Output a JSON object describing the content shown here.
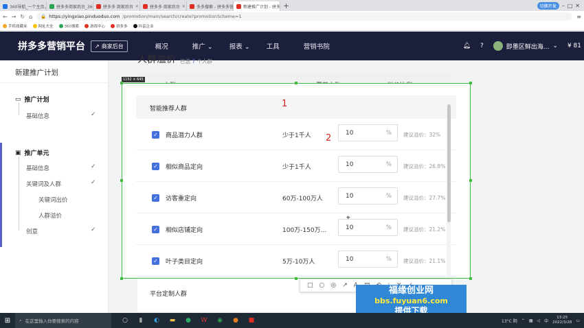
{
  "browser": {
    "tabs": [
      {
        "label": "360导航_一个主页，整个世界",
        "active": false
      },
      {
        "label": "拼多多商家后台_360搜索",
        "active": false
      },
      {
        "label": "拼多多 商家后台",
        "active": false
      },
      {
        "label": "拼多多 商家后台",
        "active": false
      },
      {
        "label": "多多搜索 - 拼多多营销平台",
        "active": false
      },
      {
        "label": "新建推广计划 - 拼多多营销平台",
        "active": true
      }
    ],
    "new_tab": "+",
    "url_host": "https://yingxiao.pinduoduo.com",
    "url_path": "/promotion/main/search/create?promotionScheme=1",
    "bookmarks": [
      "手机收藏夹",
      "网址大全",
      "360搜索",
      "游戏中心",
      "拼多多",
      "抖音企业"
    ],
    "profile_chip": "切换开发"
  },
  "header": {
    "logo": "拼多多营销平台",
    "backstage": "商家后台",
    "nav": [
      "概况",
      "推广 ⌄",
      "报表 ⌄",
      "工具",
      "营销书院"
    ],
    "user": "即墨区鲜出海...",
    "balance": "81"
  },
  "sidebar": {
    "title": "新建推广计划",
    "section1": "推广计划",
    "section1_items": [
      "基础信息"
    ],
    "section2": "推广单元",
    "section2_items": [
      "基础信息",
      "关键词及人群"
    ],
    "section2_subitems": [
      "关键词出价",
      "人群溢价"
    ],
    "section2_last": "创意",
    "check": "✓"
  },
  "page": {
    "heading": "人群溢价",
    "selected_prefix": "已选",
    "selected_count": "7",
    "selected_suffix": "个人群",
    "col_audience": "人群",
    "col_coverage": "覆盖人数",
    "col_premium": "溢价比例",
    "bottom_group": "平台定制人群"
  },
  "overlay": {
    "size_badge": "1152 × 645",
    "group_title": "智能推荐人群",
    "mark1": "1",
    "mark2": "2",
    "rows": [
      {
        "name": "商品潜力人群",
        "coverage": "少于1千人",
        "value": "10",
        "unit": "%",
        "suggest": "建议溢价：32%"
      },
      {
        "name": "相似商品定向",
        "coverage": "少于1千人",
        "value": "10",
        "unit": "%",
        "suggest": "建议溢价：26.8%"
      },
      {
        "name": "访客重定向",
        "coverage": "60万-100万人",
        "value": "10",
        "unit": "%",
        "suggest": "建议溢价：27.7%"
      },
      {
        "name": "相似店铺定向",
        "coverage": "100万-150万...",
        "value": "10",
        "unit": "%",
        "suggest": "建议溢价：21.2%"
      },
      {
        "name": "叶子类目定向",
        "coverage": "5万-10万人",
        "value": "10",
        "unit": "%",
        "suggest": "建议溢价：21.1%"
      }
    ],
    "tools": [
      "□",
      "○",
      "◎",
      "↗",
      "A",
      "▤",
      "↶",
      "⤓",
      "✕",
      "✓"
    ]
  },
  "watermark": {
    "line1": "福缘创业网",
    "line2": "bbs.fuyuan6.com",
    "line3": "提供下载"
  },
  "taskbar": {
    "search_placeholder": "在这里输入你要搜索的内容",
    "weather": "13°C 阴",
    "lang": "中",
    "time": "13:25",
    "date": "2022/3/28"
  }
}
